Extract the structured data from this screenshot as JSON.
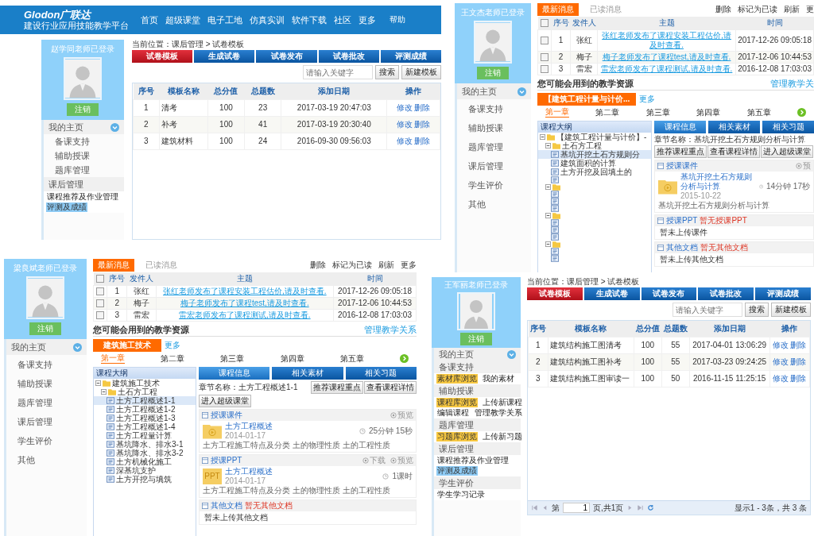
{
  "panels": [
    {
      "kind": "templates",
      "header": {
        "logo": "Glodon广联达",
        "subtitle": "建设行业应用技能教学平台",
        "nav": [
          "首页",
          "超级课堂",
          "电子工地",
          "仿真实训",
          "软件下载",
          "社区",
          "更多",
          "帮助"
        ]
      },
      "sidebar": {
        "user": "赵学同老师已登录",
        "logout": "注销",
        "entries": [
          {
            "kind": "header",
            "label": "我的主页",
            "expanded": true
          },
          {
            "kind": "item",
            "label": "备课支持"
          },
          {
            "kind": "item",
            "label": "辅助授课"
          },
          {
            "kind": "item",
            "label": "题库管理"
          },
          {
            "kind": "header",
            "label": "课后管理",
            "expanded": false
          },
          {
            "kind": "links",
            "rows": [
              [
                {
                  "label": "课程推荐及作业管理"
                }
              ],
              [
                {
                  "label": "评测及成绩",
                  "color": "#8ecbf5"
                }
              ]
            ]
          }
        ]
      },
      "breadcrumb": "当前位置：课后管理 > 试卷模板",
      "tabs": [
        {
          "label": "试卷模板",
          "selected": true
        },
        {
          "label": "生成试卷",
          "selected": false
        },
        {
          "label": "试卷发布",
          "selected": false
        },
        {
          "label": "试卷批改",
          "selected": false
        },
        {
          "label": "评测成绩",
          "selected": false
        }
      ],
      "search": {
        "placeholder": "请输入关键字"
      },
      "buttons": [
        "搜索",
        "新建模板"
      ],
      "table": {
        "columns": [
          "序号",
          "模板名称",
          "总分值",
          "总题数",
          "添加日期",
          "操作"
        ],
        "rows": [
          {
            "cells": [
              "1",
              "清考",
              "100",
              "23",
              "2017-03-19 20:47:03"
            ],
            "actions": [
              "修改",
              "删除"
            ]
          },
          {
            "cells": [
              "2",
              "补考",
              "100",
              "41",
              "2017-03-19 20:30:40"
            ],
            "actions": [
              "修改",
              "删除"
            ]
          },
          {
            "cells": [
              "3",
              "建筑材料",
              "100",
              "24",
              "2016-09-30 09:56:03"
            ],
            "actions": [
              "修改",
              "删除"
            ]
          }
        ]
      }
    },
    {
      "kind": "home",
      "sidebar": {
        "user": "王文杰老师已登录",
        "logout": "注销",
        "entries": [
          {
            "kind": "header",
            "label": "我的主页",
            "expanded": true
          },
          {
            "kind": "item",
            "label": "备课支持"
          },
          {
            "kind": "item",
            "label": "辅助授课"
          },
          {
            "kind": "item",
            "label": "题库管理"
          },
          {
            "kind": "item",
            "label": "课后管理"
          },
          {
            "kind": "item",
            "label": "学生评价"
          },
          {
            "kind": "item",
            "label": "其他"
          }
        ]
      },
      "messages": {
        "tabs": [
          {
            "label": "最新消息",
            "selected": true
          },
          {
            "label": "已读消息",
            "selected": false
          }
        ],
        "actions": [
          "删除",
          "标记为已读",
          "刷新",
          "更"
        ],
        "all_checked": false,
        "columns": [
          "序号",
          "发件人",
          "主题",
          "时间"
        ],
        "rows": [
          {
            "checked": false,
            "cells": [
              "1",
              "张红",
              "张红老师发布了课程安装工程估价,请及时查看.",
              "2017-12-26 09:05:18"
            ]
          },
          {
            "checked": false,
            "cells": [
              "2",
              "梅子",
              "梅子老师发布了课程test,请及时查看.",
              "2017-12-06 10:44:53"
            ]
          },
          {
            "checked": false,
            "cells": [
              "3",
              "雷宏",
              "雷宏老师发布了课程测试,请及时查看.",
              "2016-12-08 17:03:03"
            ]
          }
        ]
      },
      "resources": {
        "title": "您可能会用到的教学资源",
        "manage": "管理教学关",
        "course": "【建筑工程计量与计价...",
        "more": "更多",
        "chapters": [
          {
            "label": "第一章",
            "selected": true
          },
          {
            "label": "第二章",
            "selected": false
          },
          {
            "label": "第三章",
            "selected": false
          },
          {
            "label": "第四章",
            "selected": false
          },
          {
            "label": "第五章",
            "selected": false
          }
        ],
        "outline": {
          "title": "课程大纲",
          "tree": [
            {
              "label": "【建筑工程计量与计价】-",
              "selected": false,
              "children": [
                {
                  "label": "土石方工程",
                  "selected": false,
                  "children": [
                    {
                      "label": "基坑开挖土石方规则分",
                      "selected": true
                    },
                    {
                      "label": "建筑面积的计算",
                      "selected": false
                    },
                    {
                      "label": "土方开挖及回填土的",
                      "selected": false
                    },
                    {
                      "selected": false
                    }
                  ]
                },
                {
                  "selected": false,
                  "children": [
                    {
                      "selected": false
                    },
                    {
                      "selected": false
                    },
                    {
                      "selected": false
                    }
                  ]
                },
                {
                  "selected": false,
                  "children": [
                    {
                      "selected": false
                    },
                    {
                      "selected": false
                    },
                    {
                      "selected": false
                    }
                  ]
                },
                {
                  "selected": false,
                  "children": [
                    {
                      "selected": false
                    },
                    {
                      "selected": false
                    }
                  ]
                }
              ]
            }
          ]
        },
        "tabs": [
          {
            "label": "课程信息",
            "selected": true
          },
          {
            "label": "相关素材",
            "selected": false
          },
          {
            "label": "相关习题",
            "selected": false
          }
        ],
        "chapter_name": "章节名称：基坑开挖土石方规则分析与计算",
        "buttons": [
          "推荐课程重点",
          "查看课程详情",
          "进入超级课堂"
        ],
        "sections": [
          {
            "title": "授课课件",
            "actions": [
              "预"
            ],
            "items": [
              {
                "kind": "video",
                "title": "基坑开挖土石方规则分析与计算",
                "date": "2015-10-22",
                "duration": "14分钟 17秒",
                "desc": "基坑开挖土石方规则分析与计算"
              }
            ]
          },
          {
            "title": "授课PPT",
            "note": "暂无授课PPT",
            "empty": "暂未上传课件"
          },
          {
            "title": "其他文档",
            "note": "暂无其他文档",
            "empty": "暂未上传其他文档"
          }
        ]
      }
    },
    {
      "kind": "home",
      "sidebar": {
        "user": "梁良斌老师已登录",
        "logout": "注销",
        "entries": [
          {
            "kind": "header",
            "label": "我的主页",
            "expanded": true
          },
          {
            "kind": "item",
            "label": "备课支持"
          },
          {
            "kind": "item",
            "label": "辅助授课"
          },
          {
            "kind": "item",
            "label": "题库管理"
          },
          {
            "kind": "item",
            "label": "课后管理"
          },
          {
            "kind": "item",
            "label": "学生评价"
          },
          {
            "kind": "item",
            "label": "其他"
          }
        ]
      },
      "messages": {
        "tabs": [
          {
            "label": "最新消息",
            "selected": true
          },
          {
            "label": "已读消息",
            "selected": false
          }
        ],
        "actions": [
          "删除",
          "标记为已读",
          "刷新",
          "更多"
        ],
        "all_checked": false,
        "columns": [
          "序号",
          "发件人",
          "主题",
          "时间"
        ],
        "rows": [
          {
            "checked": false,
            "cells": [
              "1",
              "张红",
              "张红老师发布了课程安装工程估价,请及时查看.",
              "2017-12-26 09:05:18"
            ]
          },
          {
            "checked": false,
            "cells": [
              "2",
              "梅子",
              "梅子老师发布了课程test,请及时查看.",
              "2017-12-06 10:44:53"
            ]
          },
          {
            "checked": false,
            "cells": [
              "3",
              "雷宏",
              "雷宏老师发布了课程测试,请及时查看.",
              "2016-12-08 17:03:03"
            ]
          }
        ]
      },
      "resources": {
        "title": "您可能会用到的教学资源",
        "manage": "管理教学关系",
        "course": "建筑施工技术",
        "more": "更多",
        "chapters": [
          {
            "label": "第一章",
            "selected": true
          },
          {
            "label": "第二章",
            "selected": false
          },
          {
            "label": "第三章",
            "selected": false
          },
          {
            "label": "第四章",
            "selected": false
          },
          {
            "label": "第五章",
            "selected": false
          }
        ],
        "outline": {
          "title": "课程大纲",
          "tree": [
            {
              "label": "建筑施工技术",
              "selected": false,
              "children": [
                {
                  "label": "土石方工程",
                  "selected": false,
                  "children": [
                    {
                      "label": "土方工程概述1-1",
                      "selected": true
                    },
                    {
                      "label": "土方工程概述1-2",
                      "selected": false
                    },
                    {
                      "label": "土方工程概述1-3",
                      "selected": false
                    },
                    {
                      "label": "土方工程概述1-4",
                      "selected": false
                    },
                    {
                      "label": "土方工程量计算",
                      "selected": false
                    },
                    {
                      "label": "基坑降水、排水3-1",
                      "selected": false
                    },
                    {
                      "label": "基坑降水、排水3-2",
                      "selected": false
                    },
                    {
                      "label": "土方机械化施工",
                      "selected": false
                    },
                    {
                      "label": "深基坑支护",
                      "selected": false
                    },
                    {
                      "label": "土方开挖与填筑",
                      "selected": false
                    }
                  ]
                }
              ]
            }
          ]
        },
        "tabs": [
          {
            "label": "课程信息",
            "selected": true
          },
          {
            "label": "相关素材",
            "selected": false
          },
          {
            "label": "相关习题",
            "selected": false
          }
        ],
        "chapter_name": "章节名称：土方工程概述1-1",
        "buttons": [
          "推荐课程重点",
          "查看课程详情",
          "进入超级课堂"
        ],
        "sections": [
          {
            "title": "授课课件",
            "actions": [
              "预览"
            ],
            "items": [
              {
                "kind": "video",
                "title": "土方工程概述",
                "date": "2014-01-17",
                "duration": "25分钟 15秒",
                "desc": "土方工程施工特点及分类 土的物理性质 土的工程性质"
              }
            ]
          },
          {
            "title": "授课PPT",
            "actions": [
              "下载",
              "预览"
            ],
            "items": [
              {
                "kind": "ppt",
                "badge": "PPT",
                "title": "土方工程概述",
                "date": "2014-01-17",
                "duration": "1课时",
                "desc": "土方工程施工特点及分类 土的物理性质 土的工程性质"
              }
            ]
          },
          {
            "title": "其他文档",
            "note": "暂无其他文档",
            "empty": "暂未上传其他文档"
          }
        ]
      }
    },
    {
      "kind": "templates",
      "sidebar": {
        "user": "王军丽老师已登录",
        "logout": "注销",
        "entries": [
          {
            "kind": "header",
            "label": "我的主页",
            "expanded": true
          },
          {
            "kind": "header",
            "label": "备课支持",
            "expanded": false
          },
          {
            "kind": "links",
            "rows": [
              [
                {
                  "label": "素材库浏览",
                  "color": "#f7c842"
                },
                {
                  "label": "我的素材"
                }
              ]
            ]
          },
          {
            "kind": "header",
            "label": "辅助授课",
            "expanded": false
          },
          {
            "kind": "links",
            "rows": [
              [
                {
                  "label": "课程库浏览",
                  "color": "#f7c842"
                },
                {
                  "label": "上传新课程"
                }
              ],
              [
                {
                  "label": "编辑课程"
                },
                {
                  "label": "管理教学关系"
                }
              ]
            ]
          },
          {
            "kind": "header",
            "label": "题库管理",
            "expanded": false
          },
          {
            "kind": "links",
            "rows": [
              [
                {
                  "label": "习题库浏览",
                  "color": "#f7c842"
                },
                {
                  "label": "上传新习题"
                }
              ]
            ]
          },
          {
            "kind": "header",
            "label": "课后管理",
            "expanded": false
          },
          {
            "kind": "links",
            "rows": [
              [
                {
                  "label": "课程推荐及作业管理"
                }
              ],
              [
                {
                  "label": "评测及成绩",
                  "color": "#8ecbf5"
                }
              ]
            ]
          },
          {
            "kind": "header",
            "label": "学生评价",
            "expanded": false
          },
          {
            "kind": "links",
            "rows": [
              [
                {
                  "label": "学生学习记录"
                }
              ]
            ]
          }
        ]
      },
      "breadcrumb": "当前位置：课后管理 > 试卷模板",
      "tabs": [
        {
          "label": "试卷模板",
          "selected": true
        },
        {
          "label": "生成试卷",
          "selected": false
        },
        {
          "label": "试卷发布",
          "selected": false
        },
        {
          "label": "试卷批改",
          "selected": false
        },
        {
          "label": "评测成绩",
          "selected": false
        }
      ],
      "search": {
        "placeholder": "请输入关键字"
      },
      "buttons": [
        "搜索",
        "新建模板"
      ],
      "table": {
        "columns": [
          "序号",
          "模板名称",
          "总分值",
          "总题数",
          "添加日期",
          "操作"
        ],
        "rows": [
          {
            "cells": [
              "1",
              "建筑结构施工图清考",
              "100",
              "55",
              "2017-04-01 13:06:29"
            ],
            "actions": [
              "修改",
              "删除"
            ]
          },
          {
            "cells": [
              "2",
              "建筑结构施工图补考",
              "100",
              "55",
              "2017-03-23 09:24:25"
            ],
            "actions": [
              "修改",
              "删除"
            ]
          },
          {
            "cells": [
              "3",
              "建筑结构施工图审读一",
              "100",
              "50",
              "2016-11-15 11:25:15"
            ],
            "actions": [
              "修改",
              "删除"
            ]
          }
        ]
      },
      "pager": {
        "before": "第",
        "page": "1",
        "after": "页,共1页",
        "info": "显示1 - 3条，共 3 条"
      }
    }
  ]
}
